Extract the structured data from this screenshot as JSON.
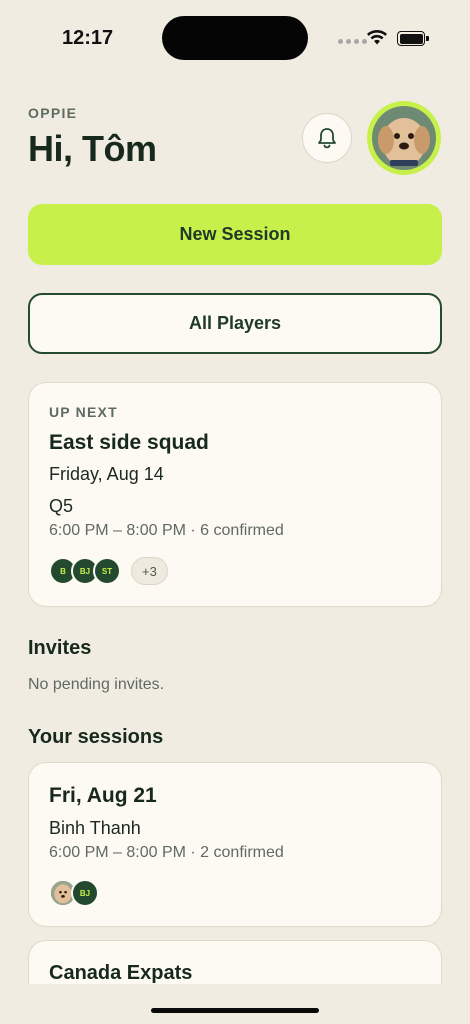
{
  "status_bar": {
    "time": "12:17"
  },
  "header": {
    "eyebrow": "OPPIE",
    "greeting": "Hi, Tôm"
  },
  "actions": {
    "new_session": "New Session",
    "all_players": "All Players"
  },
  "up_next": {
    "label": "UP NEXT",
    "title": "East side squad",
    "date": "Friday, Aug 14",
    "location": "Q5",
    "details": "6:00 PM – 8:00 PM · 6 confirmed",
    "attendees": [
      "B",
      "BJ",
      "ST"
    ],
    "more": "+3"
  },
  "invites": {
    "title": "Invites",
    "empty": "No pending invites."
  },
  "sessions": {
    "title": "Your sessions",
    "items": [
      {
        "date": "Fri, Aug 21",
        "location": "Binh Thanh",
        "details": "6:00 PM – 8:00 PM · 2 confirmed",
        "attendees": [
          "BJ"
        ]
      },
      {
        "title": "Canada Expats"
      }
    ]
  },
  "colors": {
    "accent": "#c8f04a",
    "brand_dark": "#234a2e",
    "background": "#f1ece2",
    "card": "#fdfaf3"
  }
}
